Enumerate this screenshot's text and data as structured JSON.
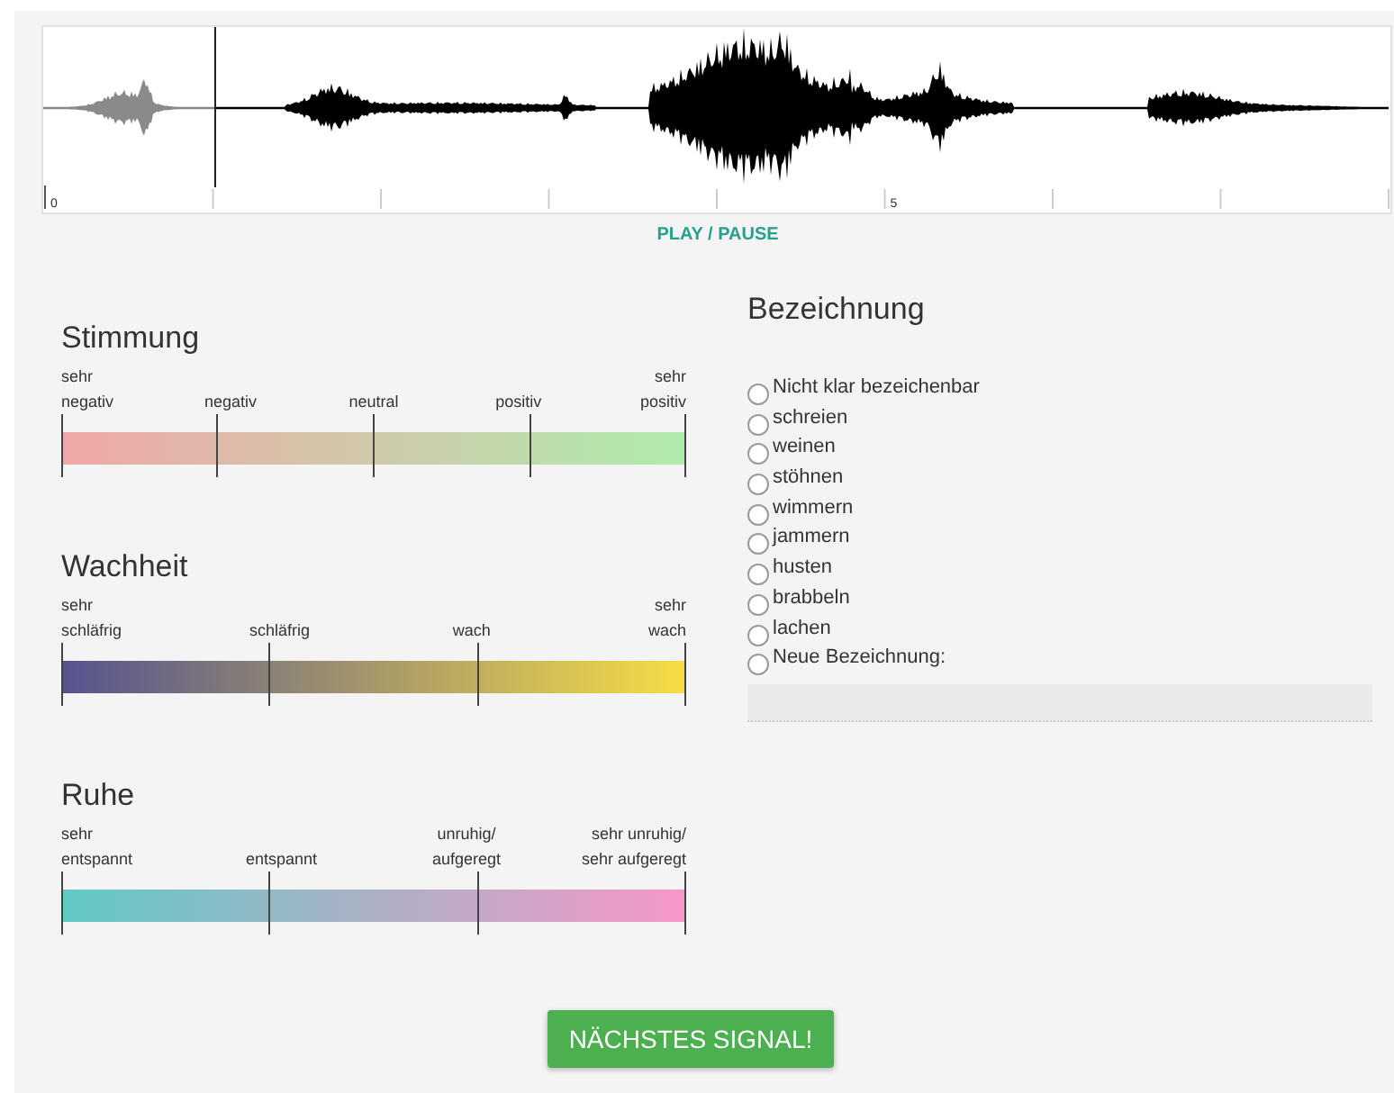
{
  "player": {
    "level": 0.127,
    "time_labels": [
      "0",
      "5"
    ],
    "play_button": "PLAY / PAUSE"
  },
  "scales": [
    {
      "title": "Stimmung",
      "kind": "mood",
      "labels": [
        "sehr\nnegativ",
        "negativ",
        "neutral",
        "positiv",
        "sehr\npositiv"
      ]
    },
    {
      "title": "Wachheit",
      "kind": "alertness",
      "labels": [
        "sehr\nschläfrig",
        "schläfrig",
        "wach",
        "sehr\nwach"
      ]
    },
    {
      "title": "Ruhe",
      "kind": "calm",
      "labels": [
        "sehr\nentspannt",
        "entspannt",
        "unruhig/\naufgeregt",
        "sehr unruhig/\nsehr aufgeregt"
      ]
    }
  ],
  "naming": {
    "title": "Bezeichnung",
    "options": [
      {
        "label": "Nicht klar bezeichenbar",
        "selected": false
      },
      {
        "label": "schreien",
        "selected": false
      },
      {
        "label": "weinen",
        "selected": false
      },
      {
        "label": "stöhnen",
        "selected": false
      },
      {
        "label": "wimmern",
        "selected": false
      },
      {
        "label": "jammern",
        "selected": false
      },
      {
        "label": "husten",
        "selected": false
      },
      {
        "label": "brabbeln",
        "selected": false
      },
      {
        "label": "lachen",
        "selected": false
      },
      {
        "label": "Neue Bezeichnung:",
        "selected": false,
        "kind": "other"
      }
    ]
  },
  "next_button": "NÄCHSTES SIGNAL!"
}
